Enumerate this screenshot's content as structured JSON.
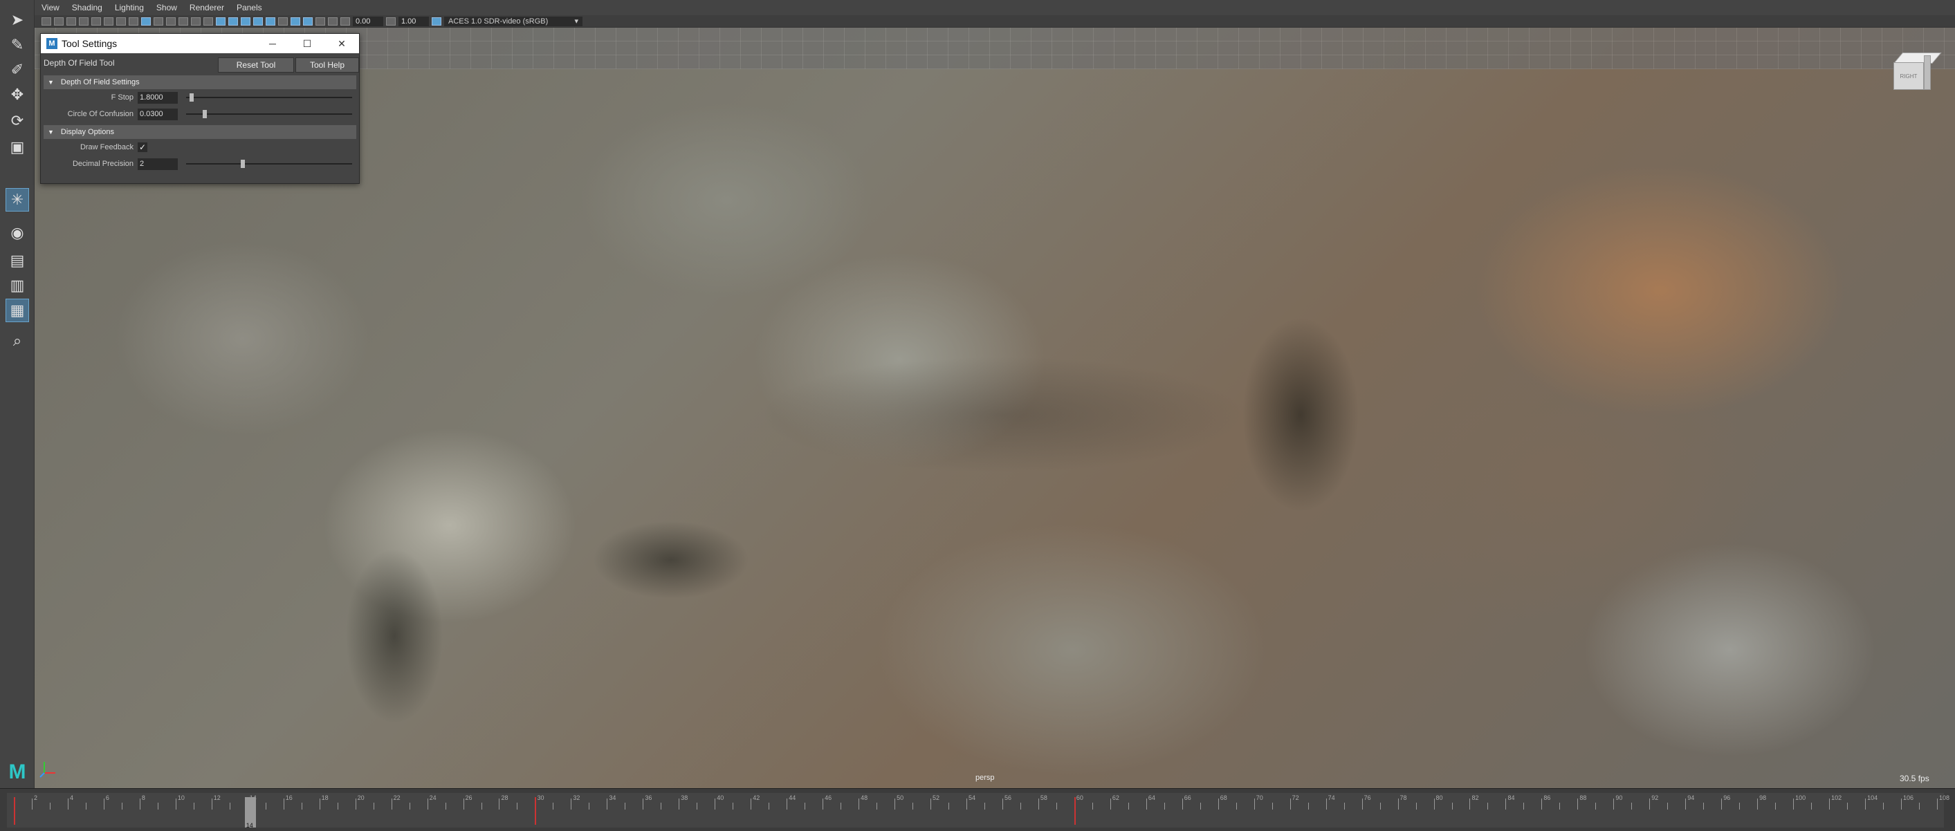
{
  "menu": [
    "View",
    "Shading",
    "Lighting",
    "Show",
    "Renderer",
    "Panels"
  ],
  "toolbar": {
    "exposure": "0.00",
    "gamma": "1.00",
    "color_space": "ACES 1.0 SDR-video (sRGB)"
  },
  "tool_settings": {
    "title": "Tool Settings",
    "tool_name": "Depth Of Field Tool",
    "reset_label": "Reset Tool",
    "help_label": "Tool Help",
    "dof_section": "Depth Of Field Settings",
    "fstop_label": "F Stop",
    "fstop_value": "1.8000",
    "fstop_level": 0.02,
    "coc_label": "Circle Of Confusion",
    "coc_value": "0.0300",
    "coc_level": 0.1,
    "display_section": "Display Options",
    "draw_feedback_label": "Draw Feedback",
    "draw_feedback_checked": true,
    "decimal_label": "Decimal Precision",
    "decimal_value": "2",
    "decimal_level": 0.33
  },
  "viewcube_label": "RIGHT",
  "viewport": {
    "camera": "persp",
    "fps": "30.5 fps"
  },
  "timeline": {
    "start": 1,
    "end": 108,
    "current_frame": "14",
    "labels": [
      2,
      4,
      6,
      8,
      10,
      12,
      14,
      16,
      18,
      20,
      22,
      24,
      26,
      28,
      30,
      32,
      34,
      36,
      38,
      40,
      42,
      44,
      46,
      48,
      50,
      52,
      54,
      56,
      58,
      60,
      62,
      64,
      66,
      68,
      70,
      72,
      74,
      76,
      78,
      80,
      82,
      84,
      86,
      88,
      90,
      92,
      94,
      96,
      98,
      100,
      102,
      104,
      106,
      108
    ],
    "keys": [
      1,
      30,
      60
    ]
  }
}
